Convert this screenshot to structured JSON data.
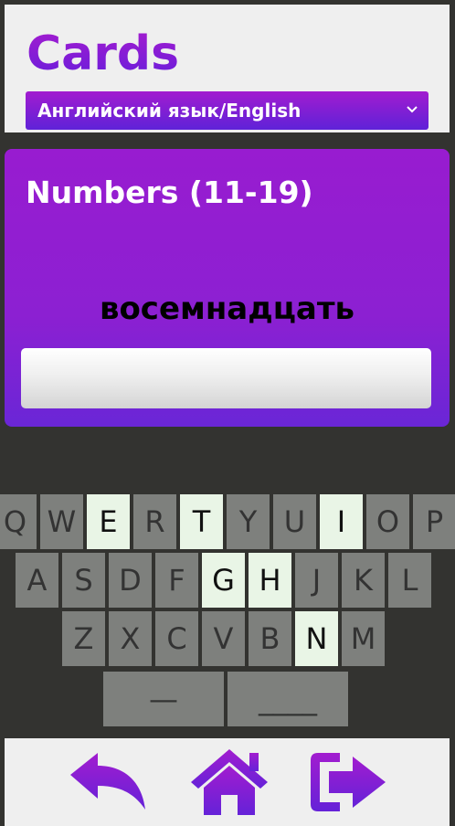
{
  "header": {
    "title": "Cards",
    "language_select": {
      "value": "Английский язык/English"
    }
  },
  "card": {
    "title": "Numbers (11-19)",
    "word": "восемнадцать",
    "answer_value": ""
  },
  "keyboard": {
    "rows": [
      [
        {
          "label": "Q",
          "highlighted": false
        },
        {
          "label": "W",
          "highlighted": false
        },
        {
          "label": "E",
          "highlighted": true
        },
        {
          "label": "R",
          "highlighted": false
        },
        {
          "label": "T",
          "highlighted": true
        },
        {
          "label": "Y",
          "highlighted": false
        },
        {
          "label": "U",
          "highlighted": false
        },
        {
          "label": "I",
          "highlighted": true
        },
        {
          "label": "O",
          "highlighted": false
        },
        {
          "label": "P",
          "highlighted": false
        }
      ],
      [
        {
          "label": "A",
          "highlighted": false
        },
        {
          "label": "S",
          "highlighted": false
        },
        {
          "label": "D",
          "highlighted": false
        },
        {
          "label": "F",
          "highlighted": false
        },
        {
          "label": "G",
          "highlighted": true
        },
        {
          "label": "H",
          "highlighted": true
        },
        {
          "label": "J",
          "highlighted": false
        },
        {
          "label": "K",
          "highlighted": false
        },
        {
          "label": "L",
          "highlighted": false
        }
      ],
      [
        {
          "label": "Z",
          "highlighted": false
        },
        {
          "label": "X",
          "highlighted": false
        },
        {
          "label": "C",
          "highlighted": false
        },
        {
          "label": "V",
          "highlighted": false
        },
        {
          "label": "B",
          "highlighted": false
        },
        {
          "label": "N",
          "highlighted": true
        },
        {
          "label": "M",
          "highlighted": false
        }
      ],
      [
        {
          "label": "—",
          "highlighted": false
        },
        {
          "label": "____",
          "highlighted": false
        }
      ]
    ]
  },
  "footer": {
    "back_icon": "back-arrow-icon",
    "home_icon": "home-icon",
    "exit_icon": "exit-icon"
  },
  "colors": {
    "accent_top": "#a21ccf",
    "accent_bottom": "#5f22d8",
    "key": "#7e807d",
    "key_highlight": "#e9f5e6",
    "background": "#333330"
  }
}
